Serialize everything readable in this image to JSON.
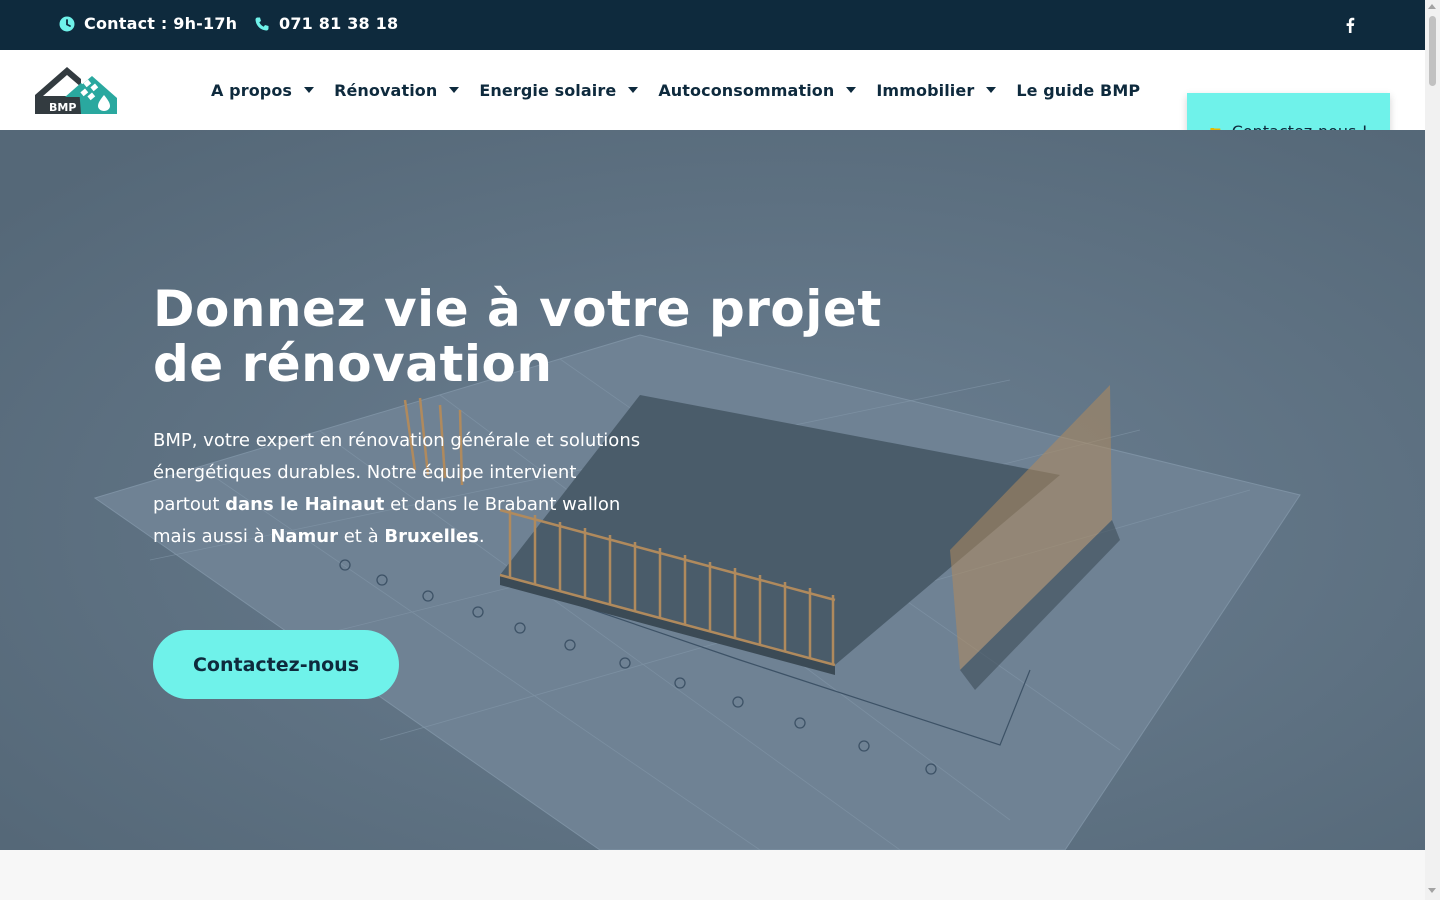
{
  "topbar": {
    "contact_hours": "Contact : 9h-17h",
    "phone": "071 81 38 18",
    "social_icon": "facebook-icon"
  },
  "header": {
    "logo_text": "BMP",
    "nav": [
      {
        "label": "A propos",
        "has_dropdown": true
      },
      {
        "label": "Rénovation",
        "has_dropdown": true
      },
      {
        "label": "Energie solaire",
        "has_dropdown": true
      },
      {
        "label": "Autoconsommation",
        "has_dropdown": true
      },
      {
        "label": "Immobilier",
        "has_dropdown": true
      },
      {
        "label": "Le guide BMP",
        "has_dropdown": false
      }
    ],
    "cta_label": "Contactez-nous !",
    "cta_icon": "pointing-hand-icon"
  },
  "hero": {
    "title": "Donnez vie à votre projet de rénovation",
    "text": {
      "p1": "BMP, votre expert en rénovation générale et solutions énergétiques durables. Notre équipe intervient partout ",
      "b1": "dans le Hainaut",
      "p2": " et dans le Brabant wallon mais aussi à ",
      "b2": "Namur",
      "p3": " et à ",
      "b3": "Bruxelles",
      "p4": "."
    },
    "button_label": "Contactez-nous"
  },
  "colors": {
    "dark": "#0e2a3d",
    "accent": "#6ff2ea",
    "hero_overlay": "#5d7182"
  }
}
